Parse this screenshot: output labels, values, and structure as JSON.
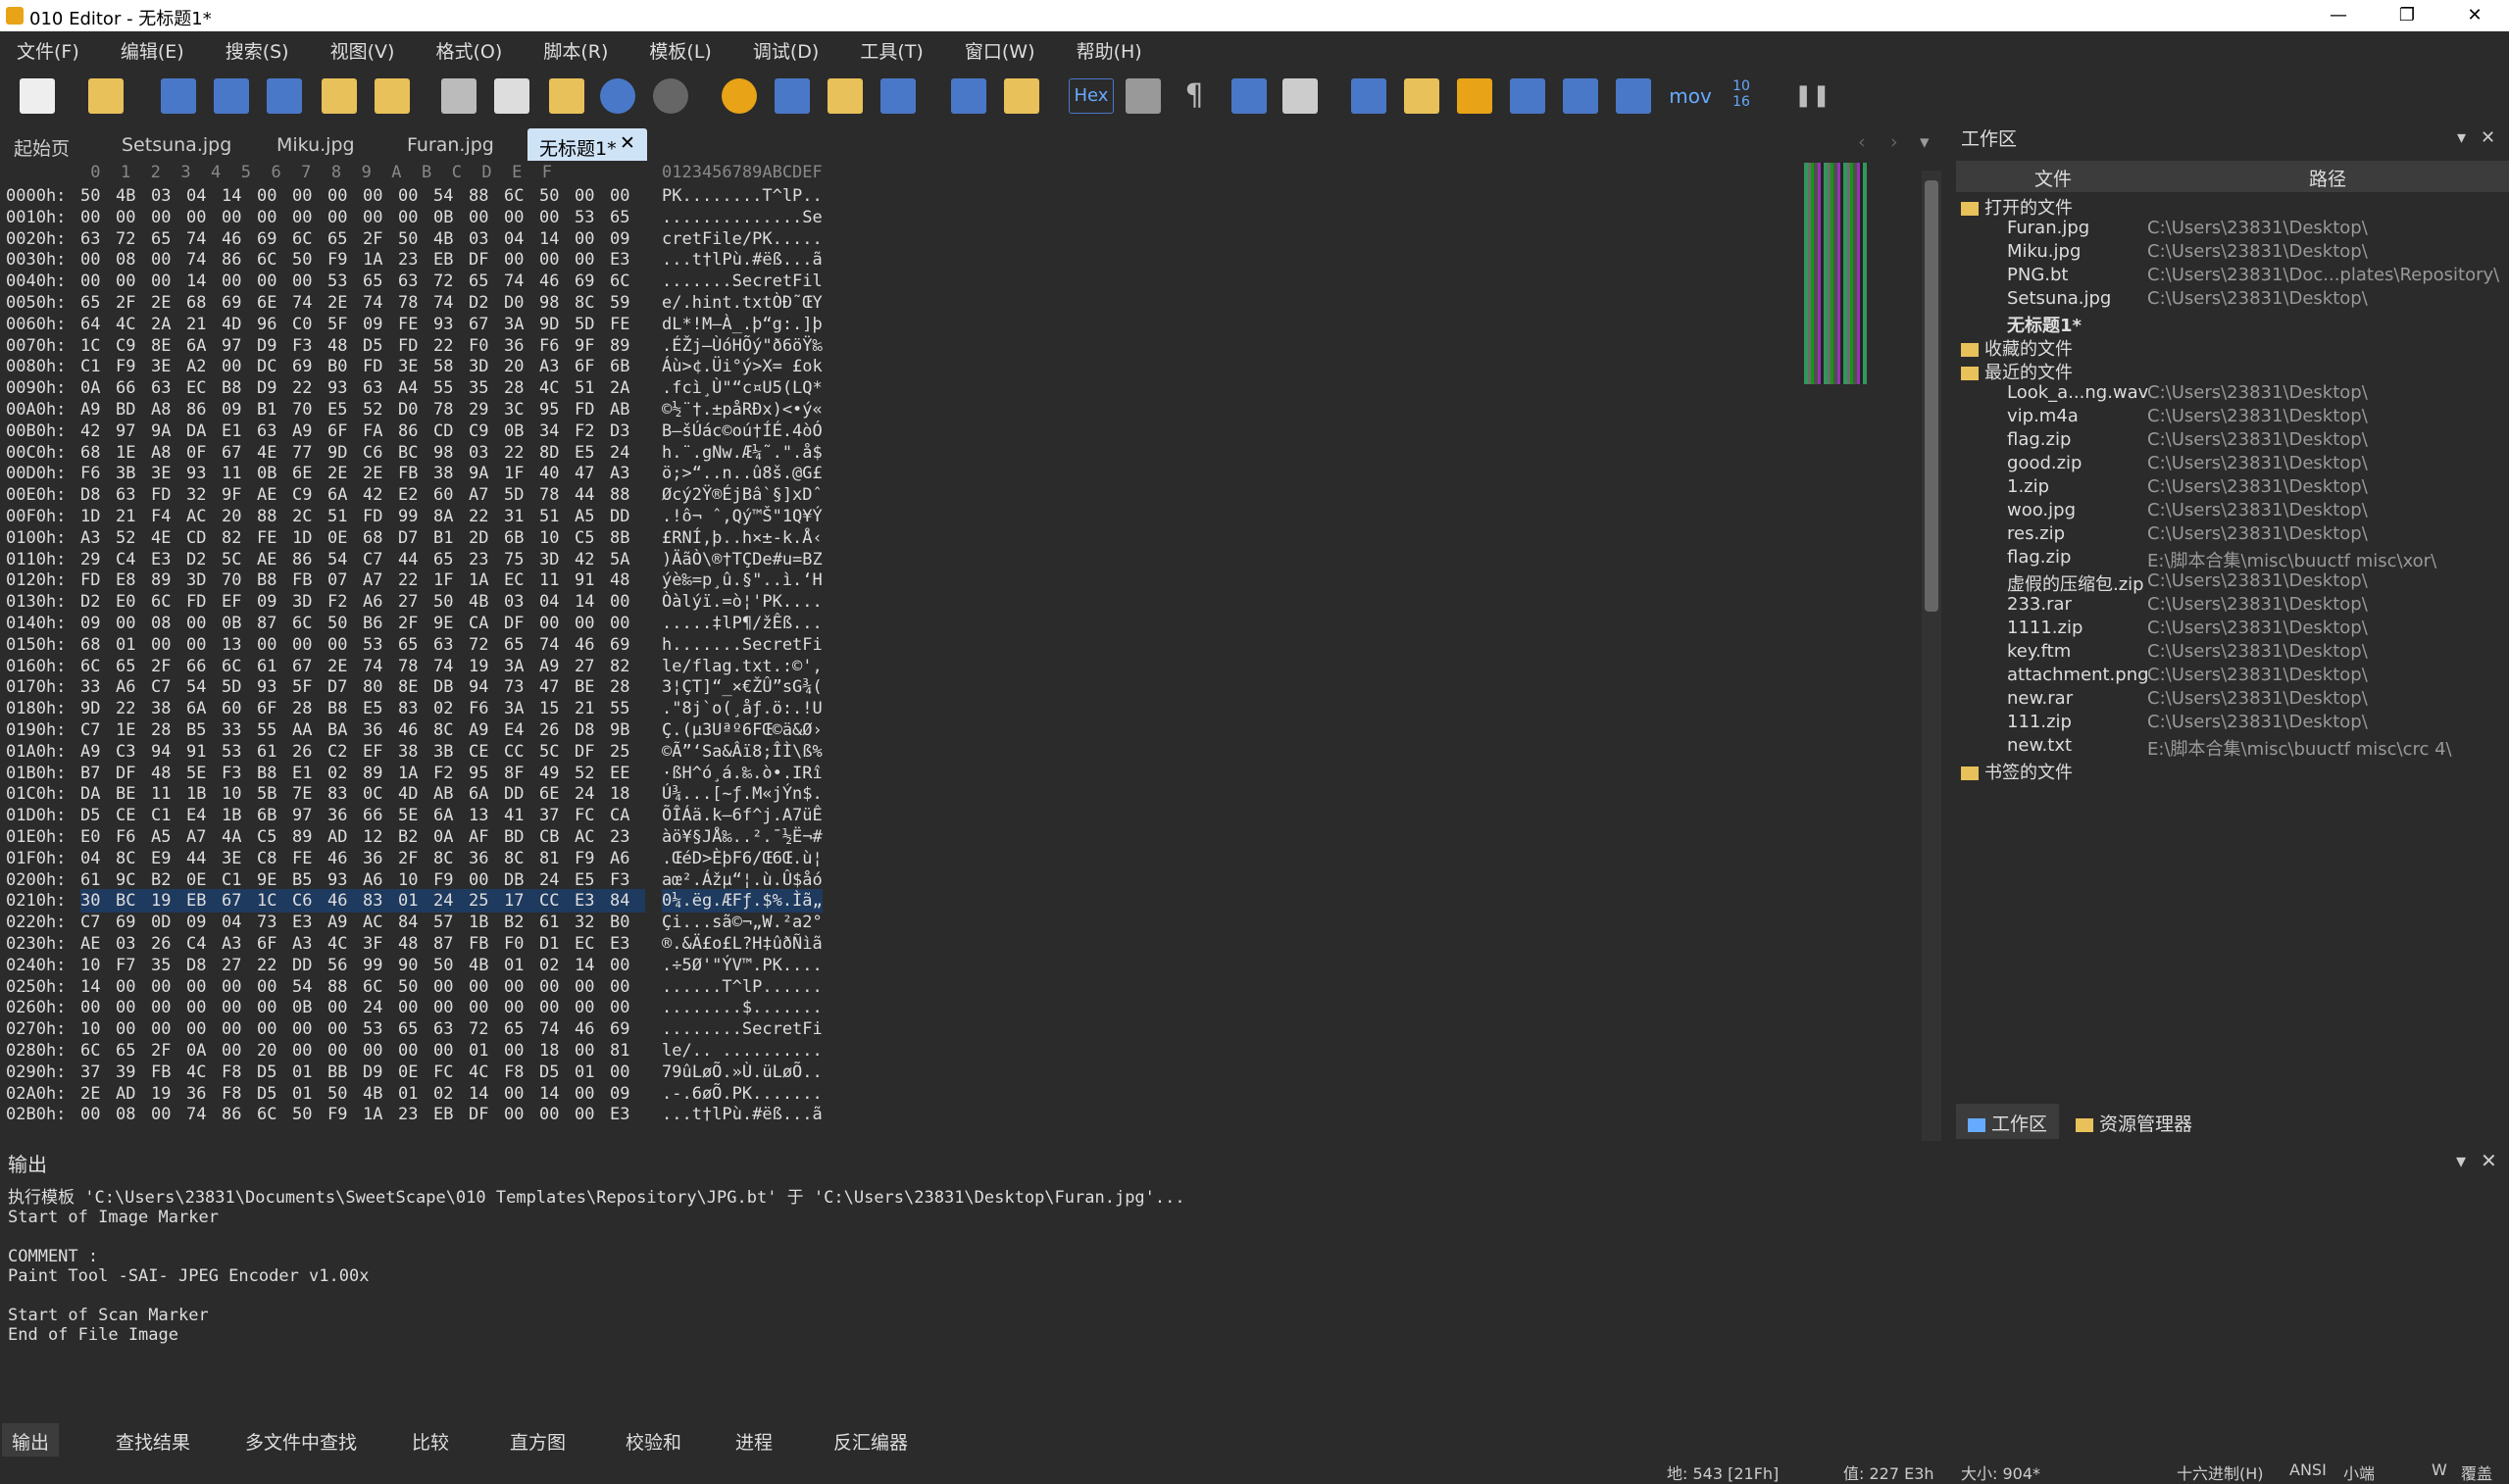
{
  "window": {
    "title": "010 Editor - 无标题1*",
    "minimize": "—",
    "maximize": "❐",
    "close": "✕"
  },
  "menu": [
    "文件(F)",
    "编辑(E)",
    "搜索(S)",
    "视图(V)",
    "格式(O)",
    "脚本(R)",
    "模板(L)",
    "调试(D)",
    "工具(T)",
    "窗口(W)",
    "帮助(H)"
  ],
  "toolbar": {
    "hex_label": "Hex",
    "mov_label": "mov",
    "base_label": "10 16"
  },
  "tabs": [
    "起始页",
    "Setsuna.jpg",
    "Miku.jpg",
    "Furan.jpg",
    "无标题1*"
  ],
  "hex": {
    "col_header": " 0  1  2  3  4  5  6  7  8  9  A  B  C  D  E  F",
    "ascii_header": "0123456789ABCDEF",
    "rows": [
      {
        "a": "0000h:",
        "h": "50 4B 03 04 14 00 00 00 00 00 54 88 6C 50 00 00",
        "t": "PK........T^lP.."
      },
      {
        "a": "0010h:",
        "h": "00 00 00 00 00 00 00 00 00 00 0B 00 00 00 53 65",
        "t": "..............Se"
      },
      {
        "a": "0020h:",
        "h": "63 72 65 74 46 69 6C 65 2F 50 4B 03 04 14 00 09",
        "t": "cretFile/PK....."
      },
      {
        "a": "0030h:",
        "h": "00 08 00 74 86 6C 50 F9 1A 23 EB DF 00 00 00 E3",
        "t": "...t†lPù.#ëß...ã"
      },
      {
        "a": "0040h:",
        "h": "00 00 00 14 00 00 00 53 65 63 72 65 74 46 69 6C",
        "t": ".......SecretFil"
      },
      {
        "a": "0050h:",
        "h": "65 2F 2E 68 69 6E 74 2E 74 78 74 D2 D0 98 8C 59",
        "t": "e/.hint.txtÒÐ˜ŒY"
      },
      {
        "a": "0060h:",
        "h": "64 4C 2A 21 4D 96 C0 5F 09 FE 93 67 3A 9D 5D FE",
        "t": "dL*!M–À_.þ“g:.]þ"
      },
      {
        "a": "0070h:",
        "h": "1C C9 8E 6A 97 D9 F3 48 D5 FD 22 F0 36 F6 9F 89",
        "t": ".ÉŽj—ÙóHÕý\"ð6öŸ‰"
      },
      {
        "a": "0080h:",
        "h": "C1 F9 3E A2 00 DC 69 B0 FD 3E 58 3D 20 A3 6F 6B",
        "t": "Áù>¢.Üi°ý>X= £ok"
      },
      {
        "a": "0090h:",
        "h": "0A 66 63 EC B8 D9 22 93 63 A4 55 35 28 4C 51 2A",
        "t": ".fcì¸Ù\"“c¤U5(LQ*"
      },
      {
        "a": "00A0h:",
        "h": "A9 BD A8 86 09 B1 70 E5 52 D0 78 29 3C 95 FD AB",
        "t": "©½¨†.±påRÐx)<•ý«"
      },
      {
        "a": "00B0h:",
        "h": "42 97 9A DA E1 63 A9 6F FA 86 CD C9 0B 34 F2 D3",
        "t": "B—šÚác©oú†ÍÉ.4òÓ"
      },
      {
        "a": "00C0h:",
        "h": "68 1E A8 0F 67 4E 77 9D C6 BC 98 03 22 8D E5 24",
        "t": "h.¨.gNw.Æ¼˜.\".å$"
      },
      {
        "a": "00D0h:",
        "h": "F6 3B 3E 93 11 0B 6E 2E 2E FB 38 9A 1F 40 47 A3",
        "t": "ö;>“..n..û8š.@G£"
      },
      {
        "a": "00E0h:",
        "h": "D8 63 FD 32 9F AE C9 6A 42 E2 60 A7 5D 78 44 88",
        "t": "Øcý2Ÿ®ÉjBâ`§]xDˆ"
      },
      {
        "a": "00F0h:",
        "h": "1D 21 F4 AC 20 88 2C 51 FD 99 8A 22 31 51 A5 DD",
        "t": ".!ô¬ ˆ,Qý™Š\"1Q¥Ý"
      },
      {
        "a": "0100h:",
        "h": "A3 52 4E CD 82 FE 1D 0E 68 D7 B1 2D 6B 10 C5 8B",
        "t": "£RNÍ‚þ..h×±-k.Å‹"
      },
      {
        "a": "0110h:",
        "h": "29 C4 E3 D2 5C AE 86 54 C7 44 65 23 75 3D 42 5A",
        "t": ")ÄãÒ\\®†TÇDe#u=BZ"
      },
      {
        "a": "0120h:",
        "h": "FD E8 89 3D 70 B8 FB 07 A7 22 1F 1A EC 11 91 48",
        "t": "ýè‰=p¸û.§\"..ì.‘H"
      },
      {
        "a": "0130h:",
        "h": "D2 E0 6C FD EF 09 3D F2 A6 27 50 4B 03 04 14 00",
        "t": "Òàlýï.=ò¦'PK...."
      },
      {
        "a": "0140h:",
        "h": "09 00 08 00 0B 87 6C 50 B6 2F 9E CA DF 00 00 00",
        "t": ".....‡lP¶/žÊß..."
      },
      {
        "a": "0150h:",
        "h": "68 01 00 00 13 00 00 00 53 65 63 72 65 74 46 69",
        "t": "h.......SecretFi"
      },
      {
        "a": "0160h:",
        "h": "6C 65 2F 66 6C 61 67 2E 74 78 74 19 3A A9 27 82",
        "t": "le/flag.txt.:©'‚"
      },
      {
        "a": "0170h:",
        "h": "33 A6 C7 54 5D 93 5F D7 80 8E DB 94 73 47 BE 28",
        "t": "3¦ÇT]“_×€ŽÛ”sG¾("
      },
      {
        "a": "0180h:",
        "h": "9D 22 38 6A 60 6F 28 B8 E5 83 02 F6 3A 15 21 55",
        "t": ".\"8j`o(¸åƒ.ö:.!U"
      },
      {
        "a": "0190h:",
        "h": "C7 1E 28 B5 33 55 AA BA 36 46 8C A9 E4 26 D8 9B",
        "t": "Ç.(µ3Uªº6FŒ©ä&Ø›"
      },
      {
        "a": "01A0h:",
        "h": "A9 C3 94 91 53 61 26 C2 EF 38 3B CE CC 5C DF 25",
        "t": "©Ã”‘Sa&Âï8;ÎÌ\\ß%"
      },
      {
        "a": "01B0h:",
        "h": "B7 DF 48 5E F3 B8 E1 02 89 1A F2 95 8F 49 52 EE",
        "t": "·ßH^ó¸á.‰.ò•.IRî"
      },
      {
        "a": "01C0h:",
        "h": "DA BE 11 1B 10 5B 7E 83 0C 4D AB 6A DD 6E 24 18",
        "t": "Ú¾...[~ƒ.M«jÝn$."
      },
      {
        "a": "01D0h:",
        "h": "D5 CE C1 E4 1B 6B 97 36 66 5E 6A 13 41 37 FC CA",
        "t": "ÕÎÁä.k—6f^j.A7üÊ"
      },
      {
        "a": "01E0h:",
        "h": "E0 F6 A5 A7 4A C5 89 AD 12 B2 0A AF BD CB AC 23",
        "t": "àö¥§JÅ‰..².¯½Ë¬#"
      },
      {
        "a": "01F0h:",
        "h": "04 8C E9 44 3E C8 FE 46 36 2F 8C 36 8C 81 F9 A6",
        "t": ".ŒéD>ÈþF6/Œ6Œ.ù¦"
      },
      {
        "a": "0200h:",
        "h": "61 9C B2 0E C1 9E B5 93 A6 10 F9 00 DB 24 E5 F3",
        "t": "aœ².Ážµ“¦.ù.Û$åó"
      },
      {
        "a": "0210h:",
        "h": "30 BC 19 EB 67 1C C6 46 83 01 24 25 17 CC E3 84",
        "t": "0¼.ëg.ÆFƒ.$%.Ìã„"
      },
      {
        "a": "0220h:",
        "h": "C7 69 0D 09 04 73 E3 A9 AC 84 57 1B B2 61 32 B0",
        "t": "Çi...sã©¬„W.²a2°"
      },
      {
        "a": "0230h:",
        "h": "AE 03 26 C4 A3 6F A3 4C 3F 48 87 FB F0 D1 EC E3",
        "t": "®.&Ä£o£L?H‡ûðÑìã"
      },
      {
        "a": "0240h:",
        "h": "10 F7 35 D8 27 22 DD 56 99 90 50 4B 01 02 14 00",
        "t": ".÷5Ø'\"ÝV™.PK...."
      },
      {
        "a": "0250h:",
        "h": "14 00 00 00 00 00 54 88 6C 50 00 00 00 00 00 00",
        "t": "......T^lP......"
      },
      {
        "a": "0260h:",
        "h": "00 00 00 00 00 00 0B 00 24 00 00 00 00 00 00 00",
        "t": "........$......."
      },
      {
        "a": "0270h:",
        "h": "10 00 00 00 00 00 00 00 53 65 63 72 65 74 46 69",
        "t": "........SecretFi"
      },
      {
        "a": "0280h:",
        "h": "6C 65 2F 0A 00 20 00 00 00 00 00 01 00 18 00 81",
        "t": "le/.. .........."
      },
      {
        "a": "0290h:",
        "h": "37 39 FB 4C F8 D5 01 BB D9 0E FC 4C F8 D5 01 00",
        "t": "79ûLøÕ.»Ù.üLøÕ.."
      },
      {
        "a": "02A0h:",
        "h": "2E AD 19 36 F8 D5 01 50 4B 01 02 14 00 14 00 09",
        "t": ".-.6øÕ.PK......."
      },
      {
        "a": "02B0h:",
        "h": "00 08 00 74 86 6C 50 F9 1A 23 EB DF 00 00 00 E3",
        "t": "...t†lPù.#ëß...ã"
      }
    ]
  },
  "workspace": {
    "title": "工作区",
    "col_file": "文件",
    "col_path": "路径",
    "open_files_label": "打开的文件",
    "open_files": [
      {
        "n": "Furan.jpg",
        "p": "C:\\Users\\23831\\Desktop\\"
      },
      {
        "n": "Miku.jpg",
        "p": "C:\\Users\\23831\\Desktop\\"
      },
      {
        "n": "PNG.bt",
        "p": "C:\\Users\\23831\\Doc...plates\\Repository\\"
      },
      {
        "n": "Setsuna.jpg",
        "p": "C:\\Users\\23831\\Desktop\\"
      },
      {
        "n": "无标题1*",
        "p": ""
      }
    ],
    "favorites_label": "收藏的文件",
    "recent_label": "最近的文件",
    "recent_files": [
      {
        "n": "Look_a...ng.wav",
        "p": "C:\\Users\\23831\\Desktop\\"
      },
      {
        "n": "vip.m4a",
        "p": "C:\\Users\\23831\\Desktop\\"
      },
      {
        "n": "flag.zip",
        "p": "C:\\Users\\23831\\Desktop\\"
      },
      {
        "n": "good.zip",
        "p": "C:\\Users\\23831\\Desktop\\"
      },
      {
        "n": "1.zip",
        "p": "C:\\Users\\23831\\Desktop\\"
      },
      {
        "n": "woo.jpg",
        "p": "C:\\Users\\23831\\Desktop\\"
      },
      {
        "n": "res.zip",
        "p": "C:\\Users\\23831\\Desktop\\"
      },
      {
        "n": "flag.zip",
        "p": "E:\\脚本合集\\misc\\buuctf misc\\xor\\"
      },
      {
        "n": "虚假的压缩包.zip",
        "p": "C:\\Users\\23831\\Desktop\\"
      },
      {
        "n": "233.rar",
        "p": "C:\\Users\\23831\\Desktop\\"
      },
      {
        "n": "1111.zip",
        "p": "C:\\Users\\23831\\Desktop\\"
      },
      {
        "n": "key.ftm",
        "p": "C:\\Users\\23831\\Desktop\\"
      },
      {
        "n": "attachment.png",
        "p": "C:\\Users\\23831\\Desktop\\"
      },
      {
        "n": "new.rar",
        "p": "C:\\Users\\23831\\Desktop\\"
      },
      {
        "n": "111.zip",
        "p": "C:\\Users\\23831\\Desktop\\"
      },
      {
        "n": "new.txt",
        "p": "E:\\脚本合集\\misc\\buuctf misc\\crc 4\\"
      }
    ],
    "bookmarks_label": "书签的文件",
    "tab_workspace": "工作区",
    "tab_explorer": "资源管理器"
  },
  "output": {
    "title": "输出",
    "lines": [
      "执行模板 'C:\\Users\\23831\\Documents\\SweetScape\\010 Templates\\Repository\\JPG.bt' 于 'C:\\Users\\23831\\Desktop\\Furan.jpg'...",
      "Start of Image Marker",
      "",
      "COMMENT :",
      "Paint Tool -SAI- JPEG Encoder v1.00x",
      "",
      "Start of Scan Marker",
      "End of File Image"
    ]
  },
  "bottom_tabs": [
    "输出",
    "查找结果",
    "多文件中查找",
    "比较",
    "直方图",
    "校验和",
    "进程",
    "反汇编器"
  ],
  "status": {
    "pos": "地: 543 [21Fh]",
    "val": "值: 227 E3h",
    "size": "大小: 904*",
    "mode": "十六进制(H)",
    "enc": "ANSI",
    "endian": "小端",
    "ins": "W",
    "extra": "覆盖"
  }
}
